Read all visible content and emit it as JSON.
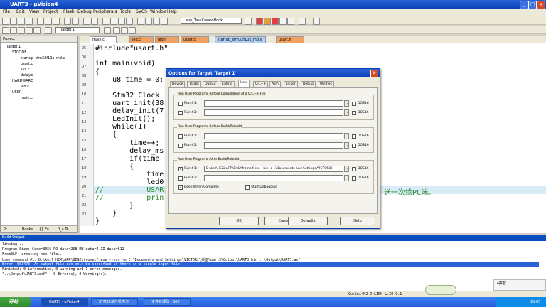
{
  "window": {
    "title": "UART3 - µVision4"
  },
  "menu": [
    "File",
    "Edit",
    "View",
    "Project",
    "Flash",
    "Debug",
    "Peripherals",
    "Tools",
    "SVCS",
    "Window",
    "Help"
  ],
  "toolbar": {
    "target_select": "Target 1",
    "function_select": "app_TaskCreateHook"
  },
  "project": {
    "title": "Project",
    "items": [
      "Target 1",
      "STCODE",
      "startup_stm32f10x_md.s",
      "usart.c",
      "sys.c",
      "delay.c",
      "HARDWARE",
      "led.c",
      "USER",
      "main.c"
    ],
    "bottom_tabs": [
      "Pr...",
      "Books",
      "{} Fu...",
      "0_a Te..."
    ]
  },
  "editor": {
    "tabs": [
      "main.c",
      "led.c",
      "led.h",
      "usart.c",
      "startup_stm32f10x_md.s",
      "usart.h"
    ],
    "line_numbers": [
      "05",
      "06",
      "07",
      "08",
      "09",
      "10",
      "11",
      "12",
      "13",
      "14",
      "15",
      "16",
      "17",
      "18",
      "19",
      "20",
      "21",
      "22",
      "23"
    ],
    "lines": [
      "#include\"usart.h\"",
      "",
      "int main(void)",
      "{",
      "    u8 time = 0;",
      "",
      "    Stm32_Clock_",
      "    uart_init(38",
      "    delay_init(7",
      "    LedInit();",
      "    while(1)",
      "    {",
      "        time++;",
      "        delay_ms",
      "        if(time",
      "        {",
      "            time",
      "            led0",
      "//          USAR",
      "//          prin",
      "        }",
      "    }",
      "}"
    ],
    "comment_tail": "送一次给PC端。"
  },
  "dialog": {
    "title": "Options for Target 'Target 1'",
    "tabs": [
      "Device",
      "Target",
      "Output",
      "Listing",
      "User",
      "C/C++",
      "Asm",
      "Linker",
      "Debug",
      "Utilities"
    ],
    "active_tab": "User",
    "groups": [
      {
        "title": "Run User Programs Before Compilation of a C/C++ File",
        "rows": [
          {
            "label": "Run #1:",
            "value": "",
            "checked": false,
            "dos": "DOS16"
          },
          {
            "label": "Run #2:",
            "value": "",
            "checked": false,
            "dos": "DOS16"
          }
        ]
      },
      {
        "title": "Run User Programs Before Build/Rebuild",
        "rows": [
          {
            "label": "Run #1:",
            "value": "",
            "checked": false,
            "dos": "DOS16"
          },
          {
            "label": "Run #2:",
            "value": "",
            "checked": false,
            "dos": "DOS16"
          }
        ]
      },
      {
        "title": "Run User Programs After Build/Rebuild",
        "rows": [
          {
            "label": "Run #1:",
            "value": "D:\\keil\\HEX2APR\\BIN2\\fromelf.exe --bin -o ..\\Documents and Settings\\VICTOR1\\",
            "checked": true,
            "dos": "DOS16"
          },
          {
            "label": "Run #2:",
            "value": "",
            "checked": false,
            "dos": "DOS16"
          }
        ]
      }
    ],
    "beep": "Beep When Complete",
    "start_debug": "Start Debugging",
    "buttons": [
      "OK",
      "Cancel",
      "Defaults",
      "Help"
    ]
  },
  "output": {
    "title": "Build Output",
    "lines": [
      "linking...",
      "Program Size: Code=3056 RO-data=268 RW-data=4 ZI-data=612",
      "FromELF: creating hex file...",
      "User command #1: D:\\keil HEX\\APR\\BIN2\\fromelf.exe --bin -o  C:\\Documents and Settings\\VICTOR1\\桌面\\uart3\\Output\\UART3.bin . \\Output\\UART3.axf",
      "Error: Q0147E: An output file can only be specified if there is a single input file",
      "Finished: 0 information, 0 warning and 1 error messages.",
      "\"..\\Output\\UART3.axf\" - 0 Error(s), 0 Warning(s)."
    ],
    "status": "Cortex-M3 J-LINK  L:20 C:1"
  },
  "taskbar": {
    "start": "开始",
    "tasks": [
      "UART3 - µVision4",
      "STM32单片机学习",
      "文件管理器 - 360"
    ],
    "ime": "A拼音",
    "clock": "10:05"
  }
}
